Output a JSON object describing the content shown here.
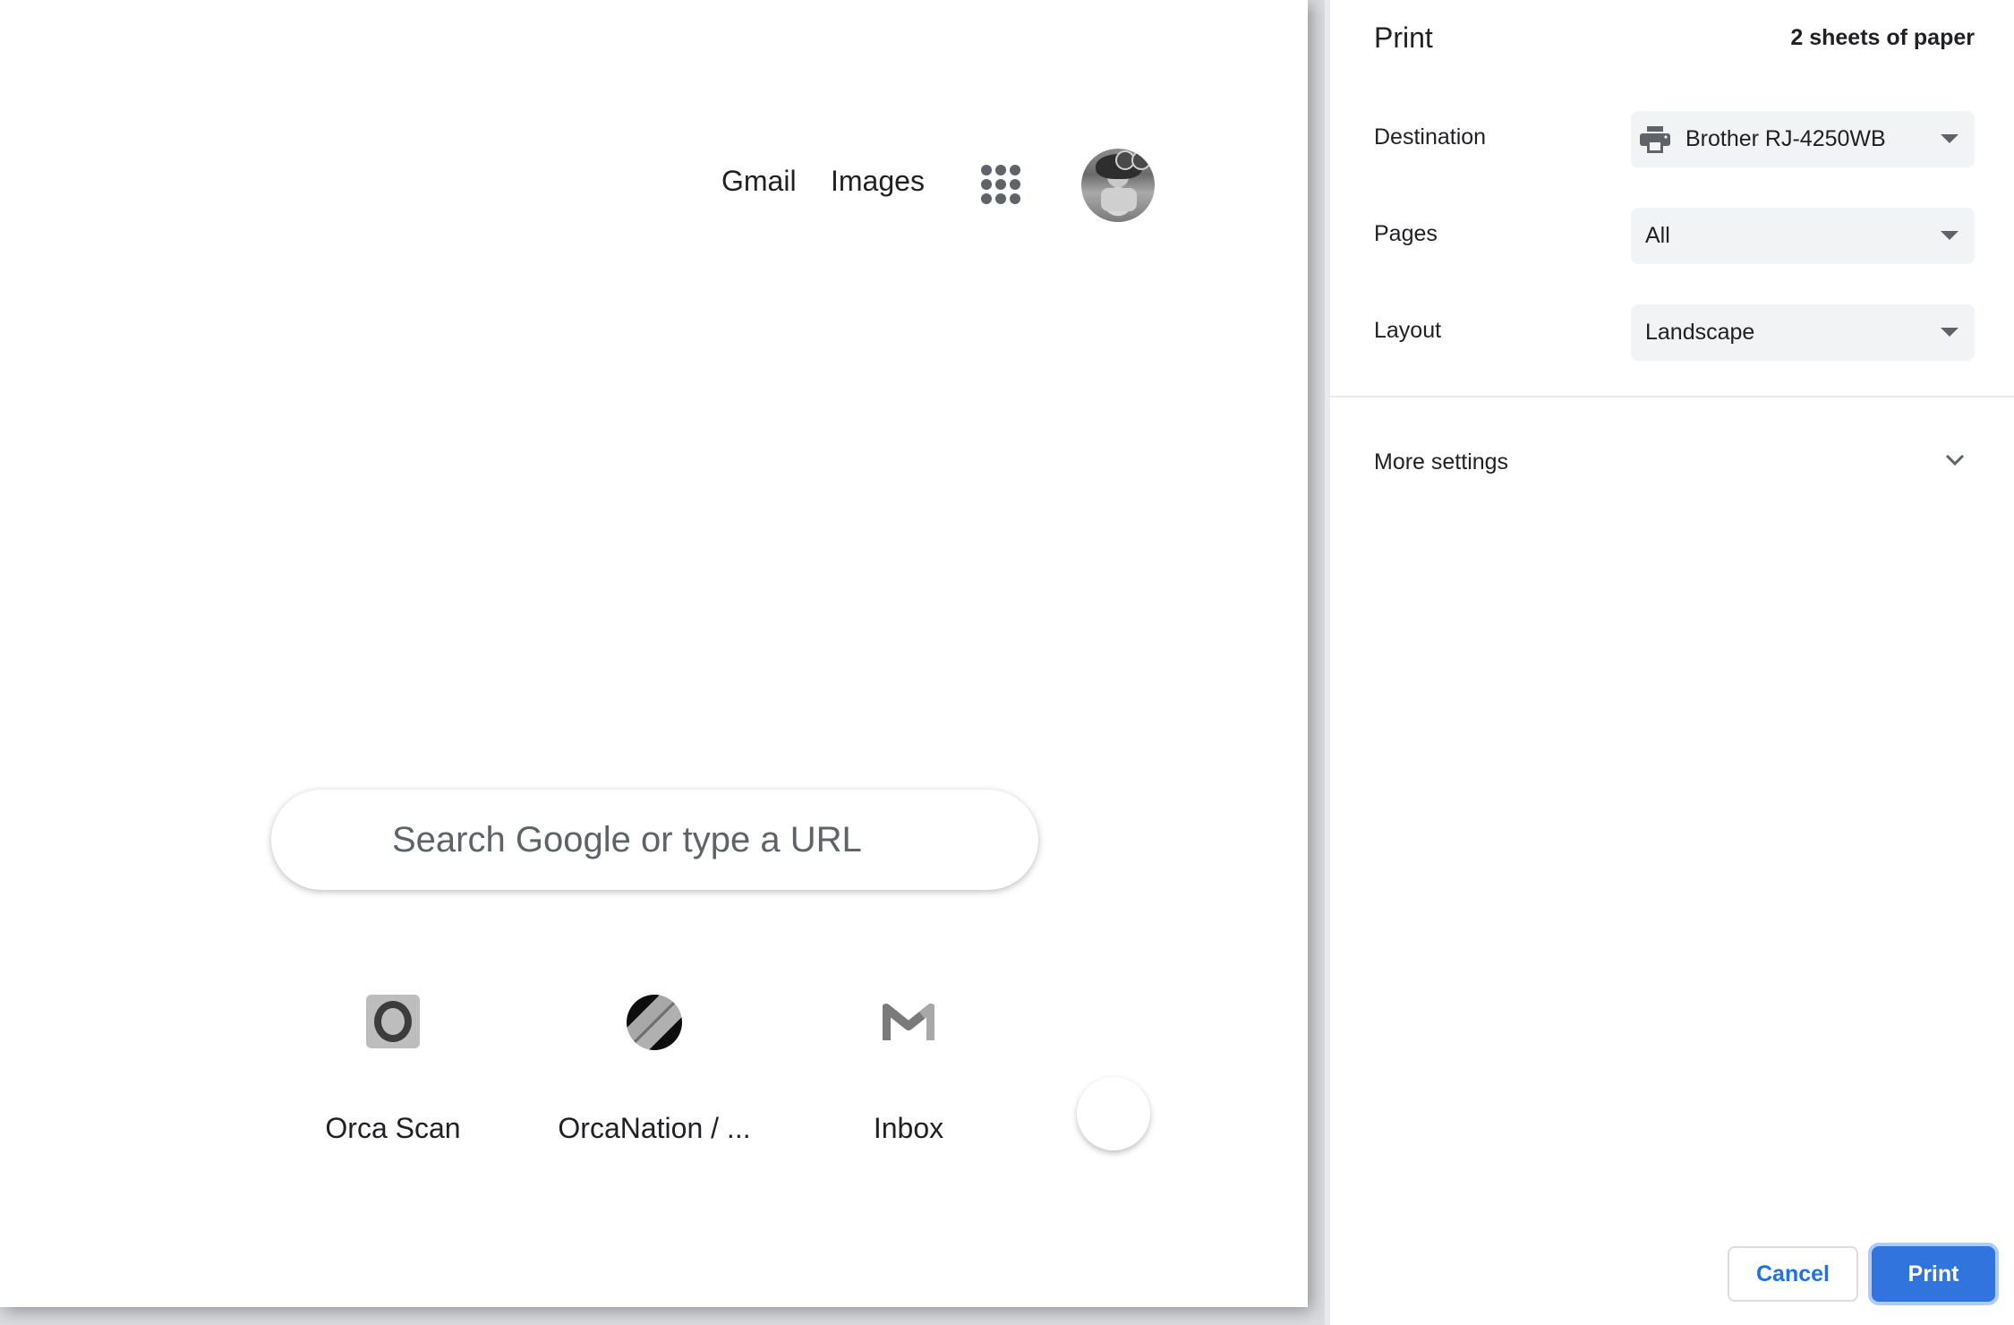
{
  "preview": {
    "header_links": [
      {
        "label": "Gmail"
      },
      {
        "label": "Images"
      }
    ],
    "apps_icon": "apps-grid-icon",
    "avatar": "profile-avatar",
    "search": {
      "placeholder": "Search Google or type a URL",
      "value": ""
    },
    "shortcuts": [
      {
        "label": "Orca Scan",
        "icon": "orca-scan-icon"
      },
      {
        "label": "OrcaNation / ...",
        "icon": "orcanation-icon"
      },
      {
        "label": "Inbox",
        "icon": "gmail-icon"
      }
    ],
    "add_shortcut_icon": "add-shortcut-button"
  },
  "print_panel": {
    "title": "Print",
    "sheet_count": "2 sheets of paper",
    "settings": {
      "destination": {
        "label": "Destination",
        "value": "Brother RJ-4250WB",
        "icon": "printer-icon"
      },
      "pages": {
        "label": "Pages",
        "value": "All"
      },
      "layout": {
        "label": "Layout",
        "value": "Landscape"
      }
    },
    "more_settings": {
      "label": "More settings",
      "icon": "chevron-down-icon"
    },
    "buttons": {
      "cancel": "Cancel",
      "print": "Print"
    },
    "colors": {
      "accent": "#1a73e8",
      "print_button_bg": "#3174de",
      "select_bg": "#f1f3f4"
    }
  }
}
